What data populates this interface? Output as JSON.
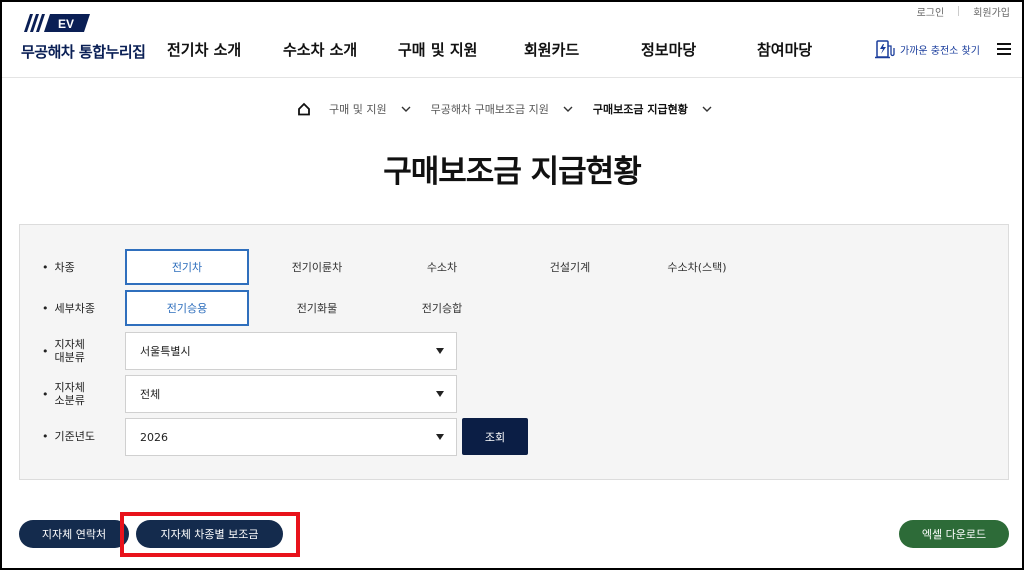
{
  "header": {
    "logo_badge": "EV",
    "site_title": "무공해차 통합누리집",
    "util_links": [
      "로그인",
      "회원가입"
    ],
    "nav": [
      "전기차 소개",
      "수소차 소개",
      "구매 및 지원",
      "회원카드",
      "정보마당",
      "참여마당"
    ],
    "charge_link": "가까운 충전소 찾기",
    "menu_icon": "hamburger-icon"
  },
  "breadcrumb": {
    "home_icon": "home-icon",
    "items": [
      "구매 및 지원",
      "무공해차 구매보조금 지원",
      "구매보조금 지급현황"
    ]
  },
  "page_title": "구매보조금 지급현황",
  "filters": {
    "vehicle_type": {
      "label": "차종",
      "options": [
        "전기차",
        "전기이륜차",
        "수소차",
        "건설기계",
        "수소차(스택)"
      ],
      "selected": "전기차"
    },
    "sub_type": {
      "label": "세부차종",
      "options": [
        "전기승용",
        "전기화물",
        "전기승합"
      ],
      "selected": "전기승용"
    },
    "region_major": {
      "label_line1": "지자체",
      "label_line2": "대분류",
      "value": "서울특별시"
    },
    "region_minor": {
      "label_line1": "지자체",
      "label_line2": "소분류",
      "value": "전체"
    },
    "base_year": {
      "label": "기준년도",
      "value": "2026"
    },
    "search_button": "조회"
  },
  "actions": {
    "contact_button": "지자체 연락처",
    "subsidy_button": "지자체 차종별 보조금",
    "excel_button": "엑셀 다운로드"
  },
  "colors": {
    "brand_navy": "#0b1e45",
    "selected_blue": "#2f6fbd",
    "excel_green": "#2d6b38",
    "highlight_red": "#e8121b"
  }
}
